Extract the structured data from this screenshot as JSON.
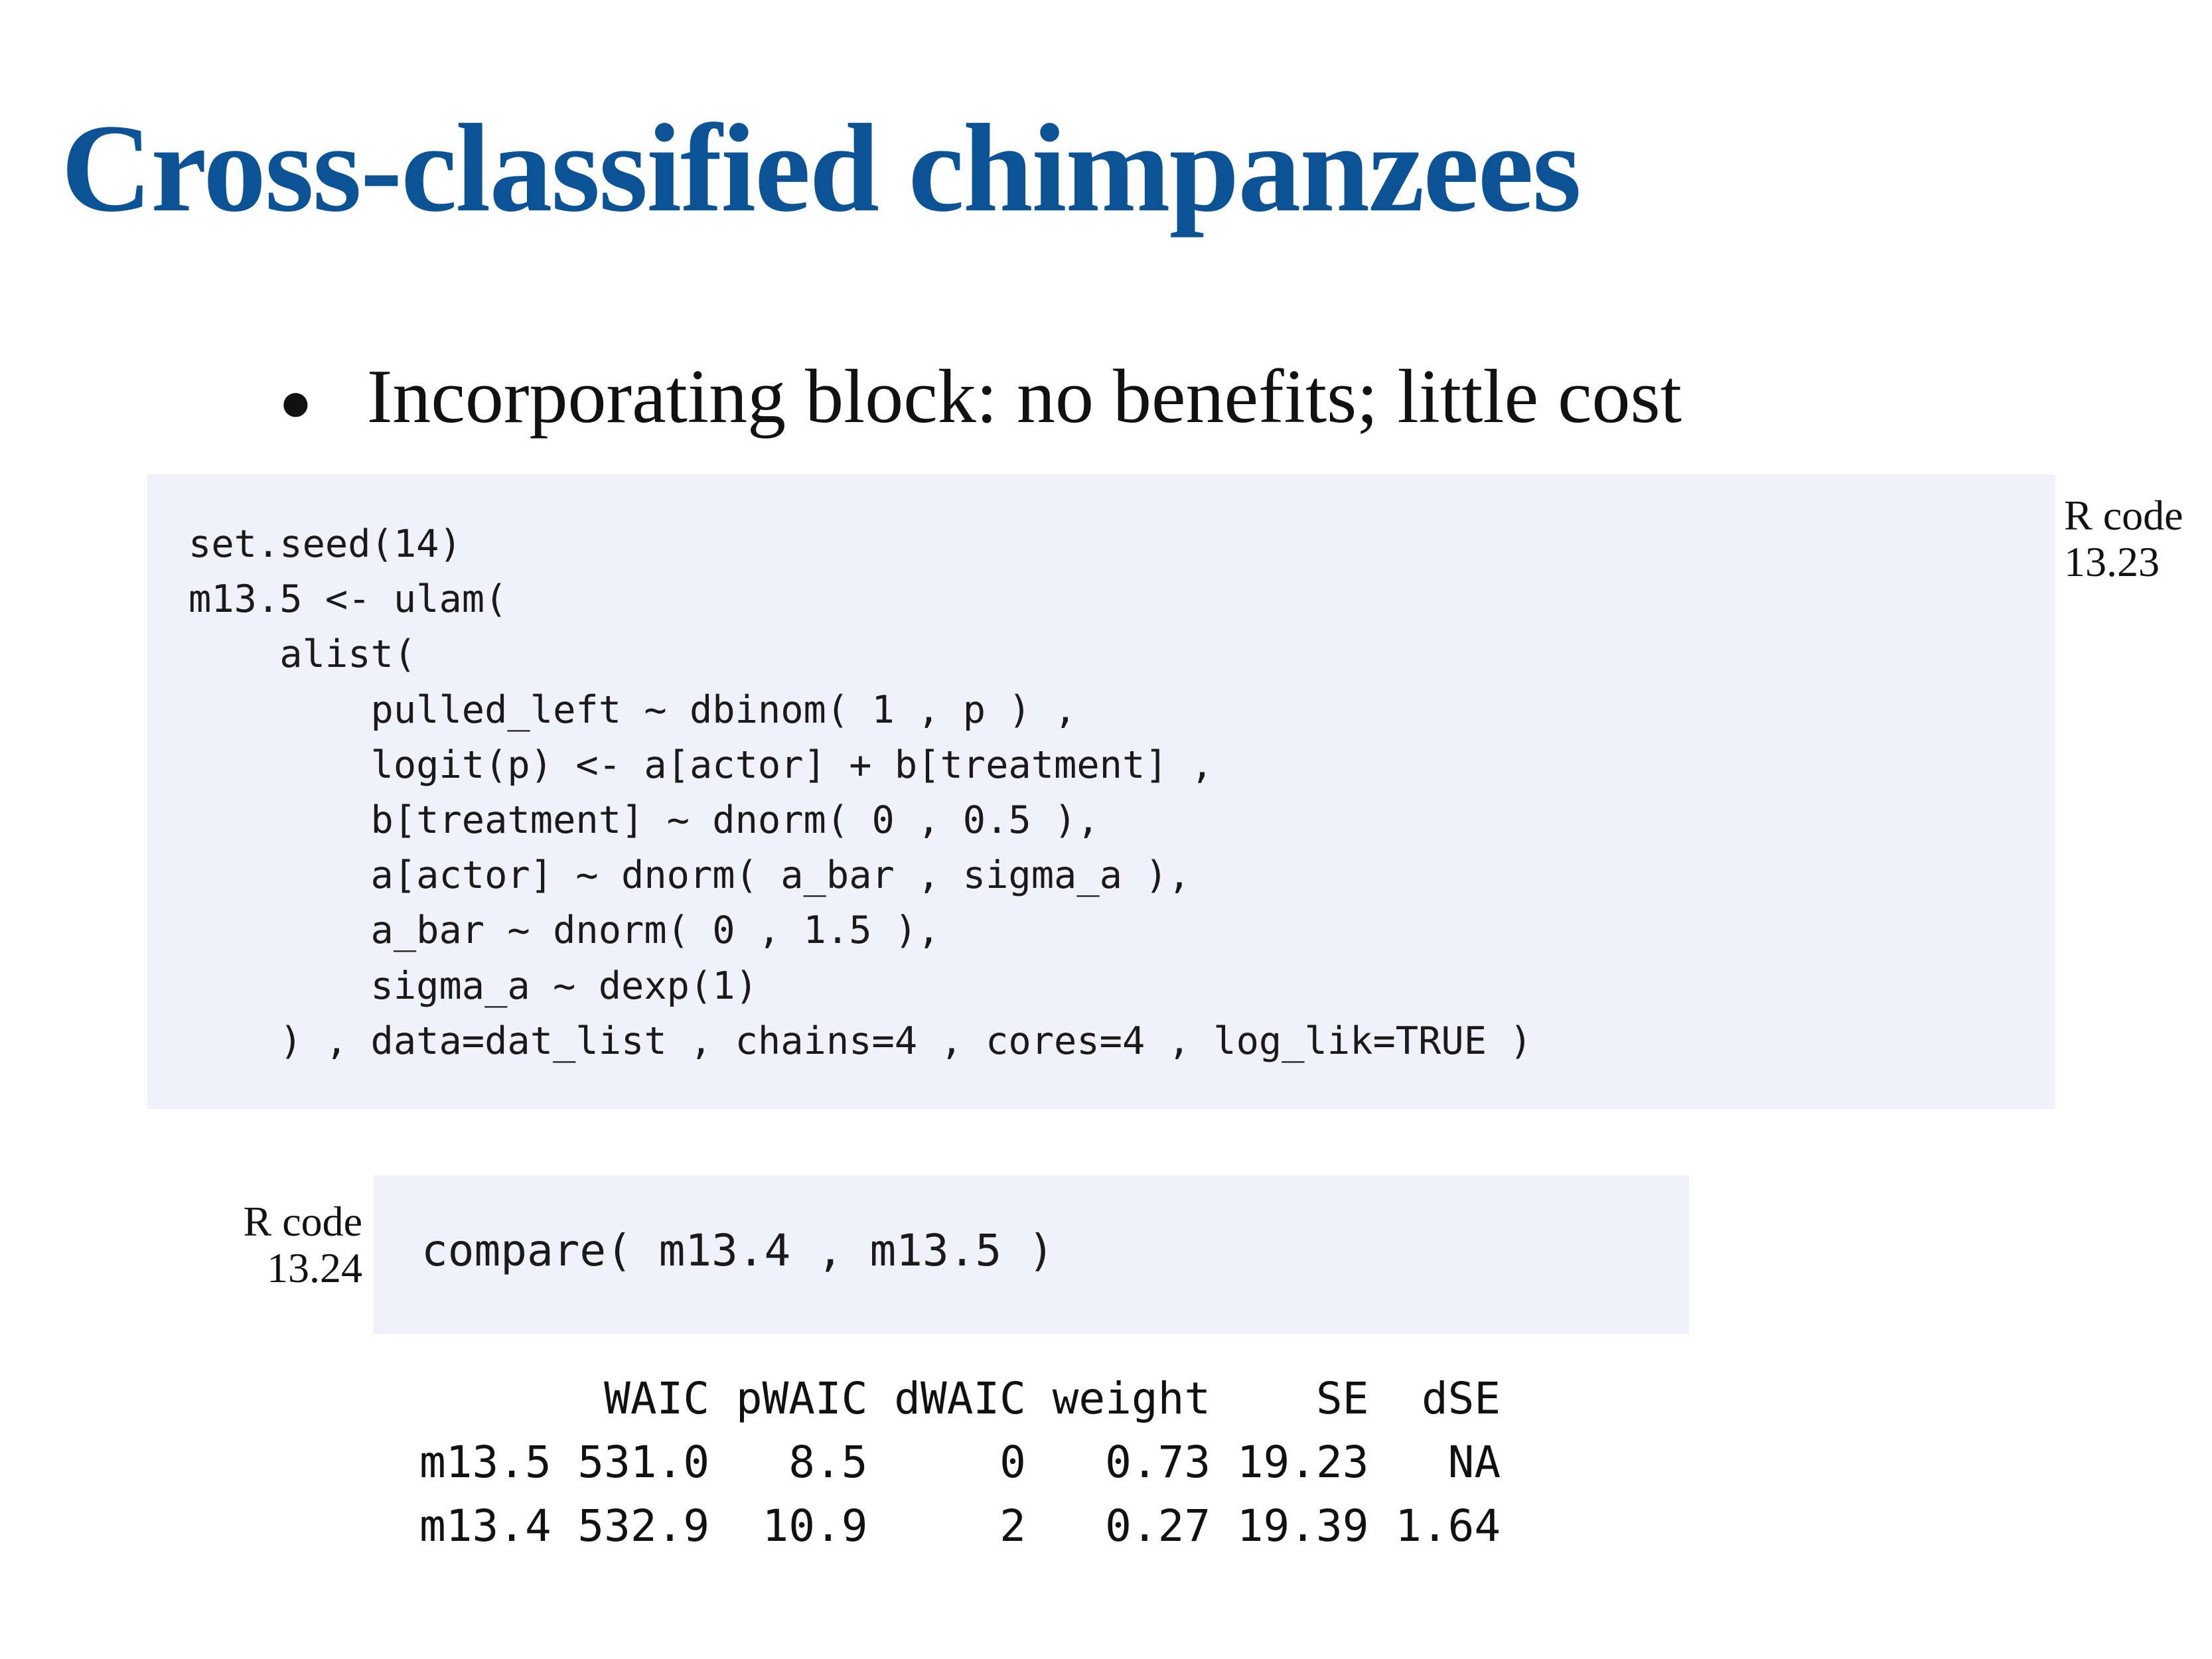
{
  "slide": {
    "title": "Cross-classified chimpanzees",
    "bullet": "Incorporating block: no benefits; little cost",
    "title_color": "#0b5394",
    "code_background": "#f0f1fa"
  },
  "code_blocks": [
    {
      "label_line1": "R code",
      "label_line2": "13.23",
      "code": "set.seed(14)\nm13.5 <- ulam(\n    alist(\n        pulled_left ~ dbinom( 1 , p ) ,\n        logit(p) <- a[actor] + b[treatment] ,\n        b[treatment] ~ dnorm( 0 , 0.5 ),\n        a[actor] ~ dnorm( a_bar , sigma_a ),\n        a_bar ~ dnorm( 0 , 1.5 ),\n        sigma_a ~ dexp(1)\n    ) , data=dat_list , chains=4 , cores=4 , log_lik=TRUE )"
    },
    {
      "label_line1": "R code",
      "label_line2": "13.24",
      "code": "compare( m13.4 , m13.5 )"
    }
  ],
  "output": "       WAIC pWAIC dWAIC weight    SE  dSE\nm13.5 531.0   8.5     0   0.73 19.23   NA\nm13.4 532.9  10.9     2   0.27 19.39 1.64"
}
